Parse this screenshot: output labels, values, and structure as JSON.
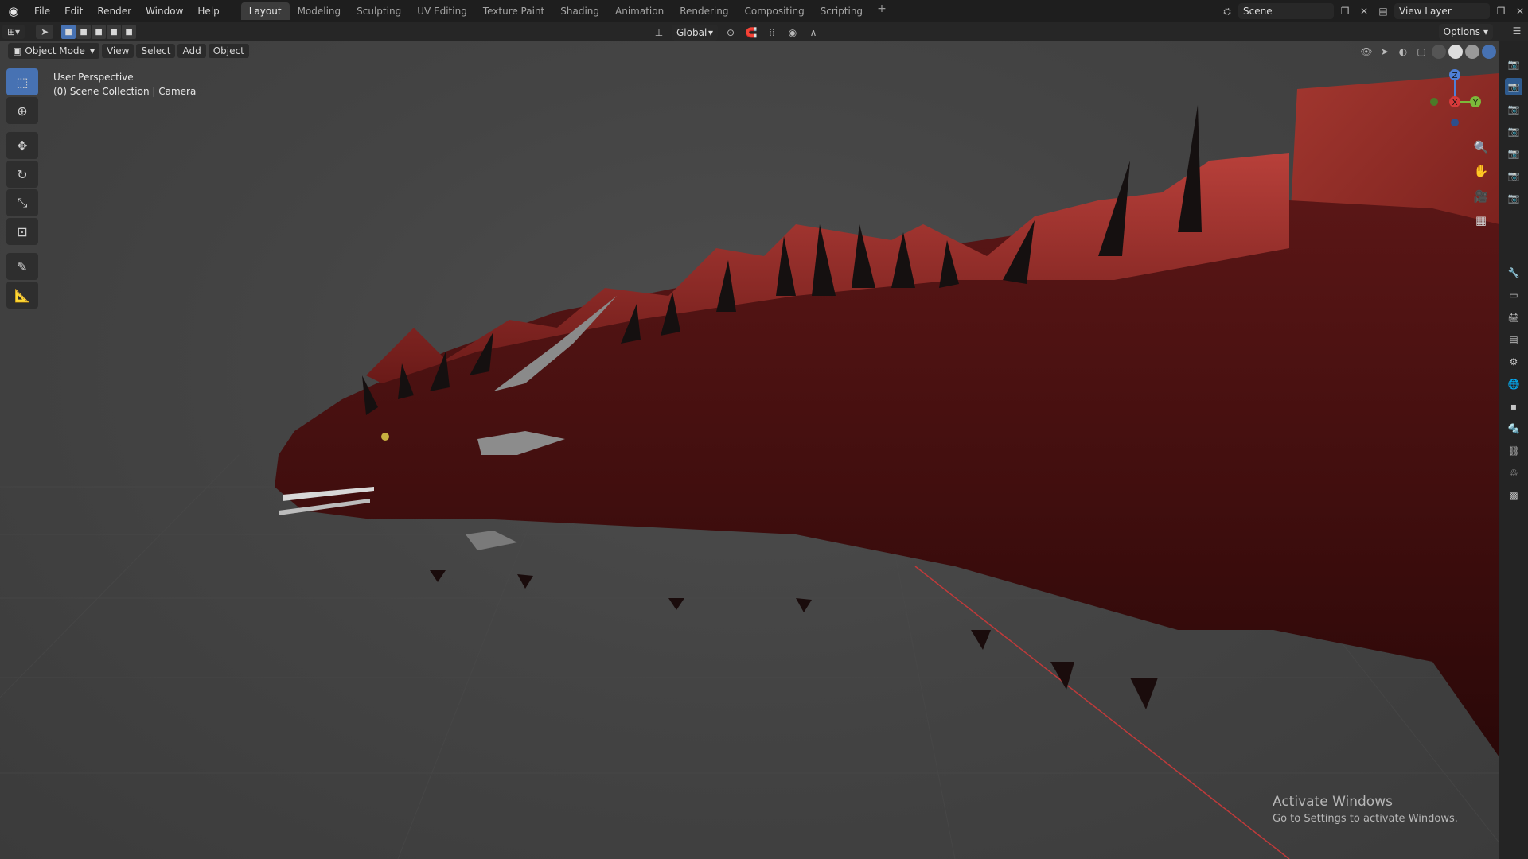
{
  "menu": {
    "items": [
      "File",
      "Edit",
      "Render",
      "Window",
      "Help"
    ]
  },
  "workspaces": {
    "tabs": [
      "Layout",
      "Modeling",
      "Sculpting",
      "UV Editing",
      "Texture Paint",
      "Shading",
      "Animation",
      "Rendering",
      "Compositing",
      "Scripting"
    ],
    "active": "Layout",
    "add": "+"
  },
  "scene": {
    "name": "Scene"
  },
  "view_layer": {
    "name": "View Layer"
  },
  "header": {
    "transform_orientation": "Global",
    "options_label": "Options"
  },
  "viewport": {
    "mode": "Object Mode",
    "menus": [
      "View",
      "Select",
      "Add",
      "Object"
    ],
    "perspective_label": "User Perspective",
    "collection_label": "(0) Scene Collection | Camera"
  },
  "gizmo": {
    "x": "X",
    "y": "Y",
    "z": "Z"
  },
  "watermark": {
    "title": "Activate Windows",
    "subtitle": "Go to Settings to activate Windows."
  },
  "colors": {
    "accent": "#4772b3",
    "dragon_red": "#7a1f1f",
    "grid_red_axis": "#c03a3a"
  }
}
